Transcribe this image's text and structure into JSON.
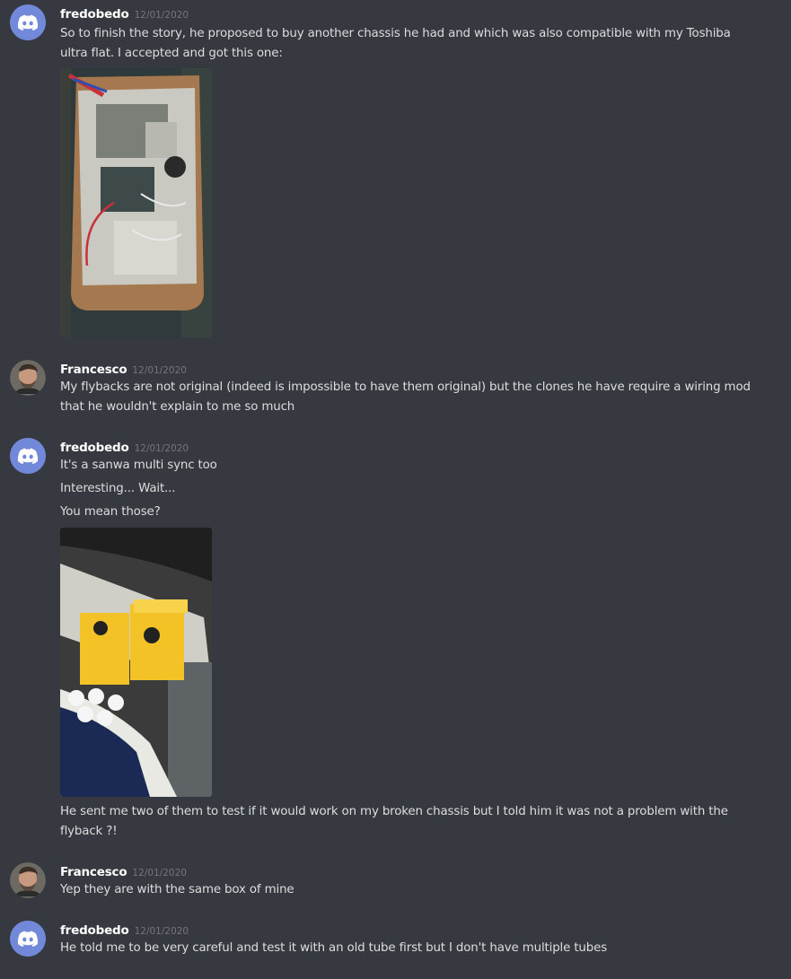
{
  "colors": {
    "background": "#36393f",
    "username": "#ffffff",
    "timestamp": "#72767d",
    "text": "#dcddde",
    "discord_blurple": "#7289da"
  },
  "groups": [
    {
      "author": "fredobedo",
      "avatar": "discord-logo-icon",
      "timestamp": "12/01/2020",
      "lines": [
        "So to finish the story, he proposed to buy another chassis he had and which was also compatible with my Toshiba",
        "ultra flat. I accepted and got this one:"
      ],
      "attachment": "photo-crt-chassis"
    },
    {
      "author": "Francesco",
      "avatar": "user-photo-icon",
      "timestamp": "12/01/2020",
      "lines": [
        "My flybacks are not original (indeed is impossible to have them original) but the clones he have require a wiring mod",
        "that he wouldn't explain to me so much"
      ]
    },
    {
      "author": "fredobedo",
      "avatar": "discord-logo-icon",
      "timestamp": "12/01/2020",
      "lines": [
        "It's a sanwa multi sync too",
        "Interesting... Wait...",
        "You mean those?"
      ],
      "attachment": "photo-flyback-boxes",
      "lines_after": [
        "He sent me two of them to test if it would work on my broken chassis but I told him it was not a problem with the",
        "flyback ?!"
      ]
    },
    {
      "author": "Francesco",
      "avatar": "user-photo-icon",
      "timestamp": "12/01/2020",
      "lines": [
        "Yep they are with the same box of mine"
      ]
    },
    {
      "author": "fredobedo",
      "avatar": "discord-logo-icon",
      "timestamp": "12/01/2020",
      "lines": [
        "He told me to be very careful and test it with an old tube first but I don't have multiple tubes"
      ]
    }
  ]
}
